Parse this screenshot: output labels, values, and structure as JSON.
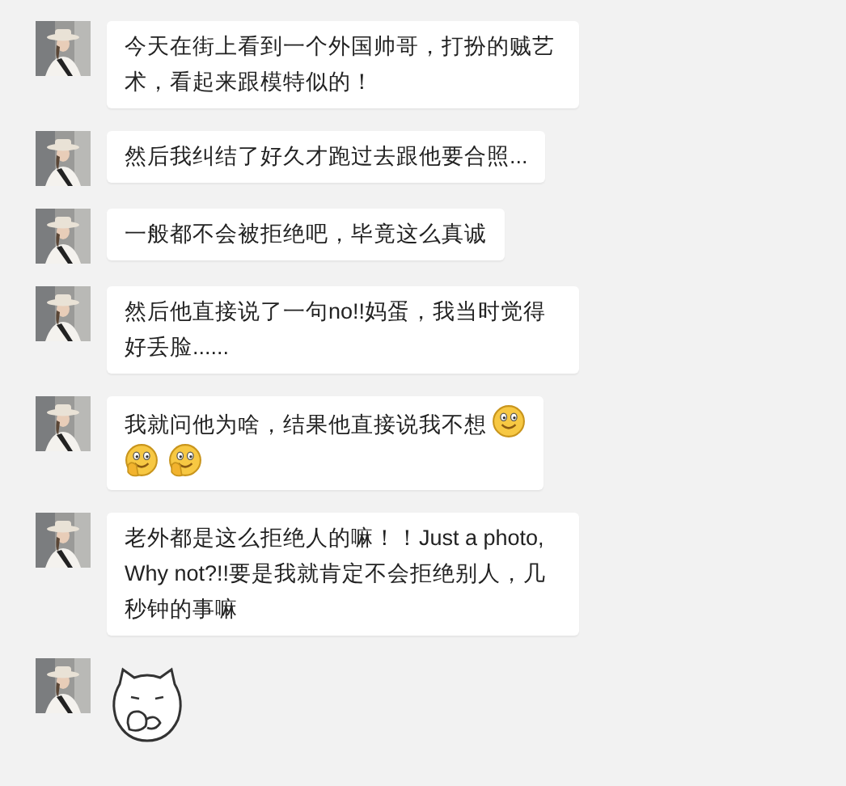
{
  "messages": [
    {
      "kind": "text",
      "text": "今天在街上看到一个外国帅哥，打扮的贼艺术，看起来跟模特似的！"
    },
    {
      "kind": "text",
      "text": "然后我纠结了好久才跑过去跟他要合照..."
    },
    {
      "kind": "text",
      "text": "一般都不会被拒绝吧，毕竟这么真诚"
    },
    {
      "kind": "text",
      "text": "然后他直接说了一句no!!妈蛋，我当时觉得好丢脸......"
    },
    {
      "kind": "text",
      "text": "我就问他为啥，结果他直接说我不想",
      "emojis": [
        {
          "kind": "smile"
        },
        {
          "kind": "thinking"
        },
        {
          "kind": "thinking"
        }
      ]
    },
    {
      "kind": "text",
      "text": "老外都是这么拒绝人的嘛！！Just a photo, Why not?!!要是我就肯定不会拒绝别人，几秒钟的事嘛"
    },
    {
      "kind": "sticker"
    }
  ]
}
